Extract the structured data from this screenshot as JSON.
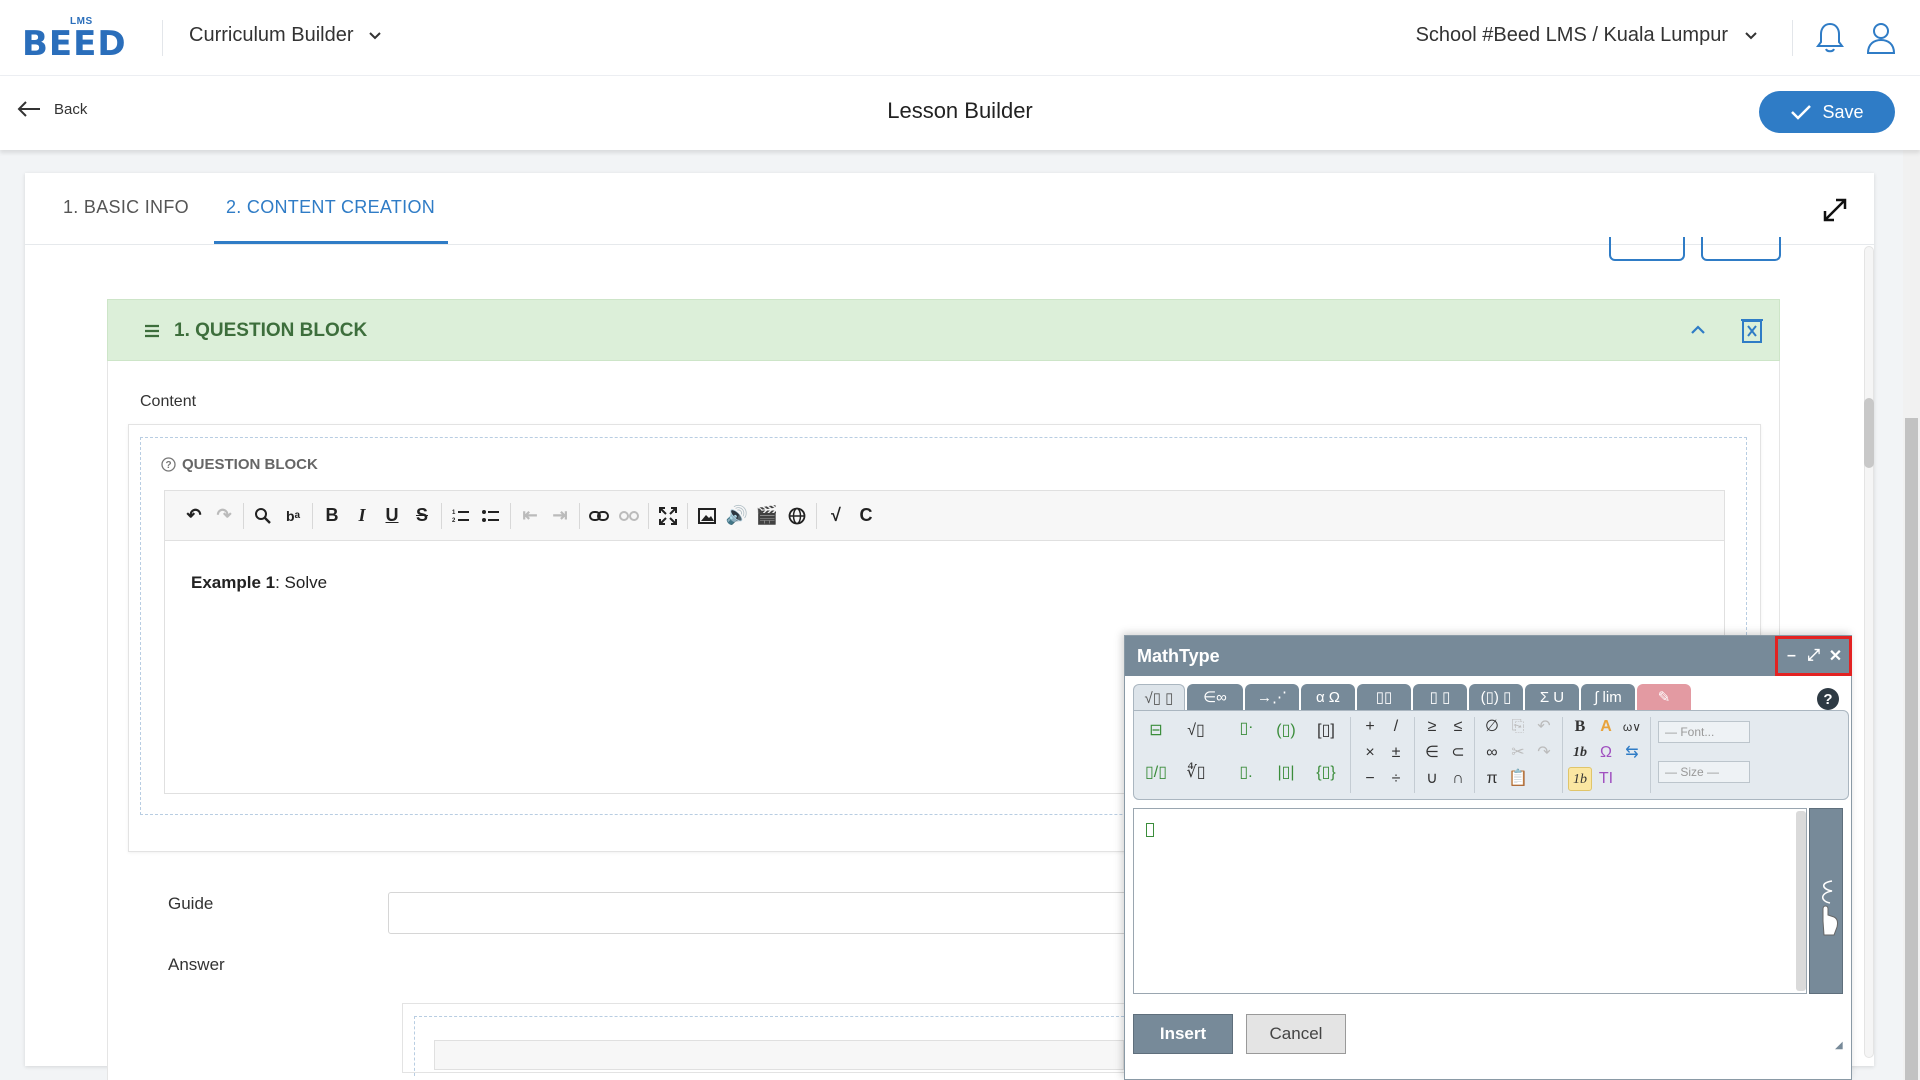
{
  "app": {
    "logo_text": "BEED",
    "logo_sup": "LMS",
    "module": "Curriculum Builder",
    "school": "School #Beed LMS / Kuala Lumpur"
  },
  "header": {
    "back_label": "Back",
    "title": "Lesson Builder",
    "save_label": "Save"
  },
  "tabs": [
    {
      "label": "1. BASIC INFO",
      "active": false
    },
    {
      "label": "2. CONTENT CREATION",
      "active": true
    }
  ],
  "block": {
    "title": "1. QUESTION BLOCK",
    "content_label": "Content",
    "inner_label": "QUESTION BLOCK",
    "editor_bold": "Example 1",
    "editor_text": ": Solve",
    "guide_label": "Guide",
    "answer_label": "Answer"
  },
  "toolbar_icons": [
    "undo-icon",
    "redo-icon",
    "search-icon",
    "replace-icon",
    "bold-icon",
    "italic-icon",
    "underline-icon",
    "strikethrough-icon",
    "numbered-list-icon",
    "bullet-list-icon",
    "outdent-icon",
    "indent-icon",
    "link-icon",
    "unlink-icon",
    "fullscreen-icon",
    "image-icon",
    "audio-icon",
    "video-icon",
    "globe-icon",
    "mathtype-icon",
    "chemtype-icon"
  ],
  "mathtype": {
    "title": "MathType",
    "tabs": [
      "√▯ ▯",
      "∈∞",
      "→⋰",
      "α Ω",
      "▯▯",
      "▯ ▯",
      "(▯) ▯",
      "Σ U",
      "∫ lim",
      "✎"
    ],
    "font_placeholder": "— Font...",
    "size_placeholder": "— Size —",
    "insert_label": "Insert",
    "cancel_label": "Cancel",
    "help_label": "?",
    "ctrl_min": "–",
    "ctrl_max": "⤢",
    "ctrl_close": "✕"
  },
  "colors": {
    "primary": "#2f7cc6",
    "block_header_bg": "#dcefd9",
    "block_header_text": "#3d6e3c",
    "mathtype_bar": "#778a99",
    "highlight": "#e32222"
  }
}
